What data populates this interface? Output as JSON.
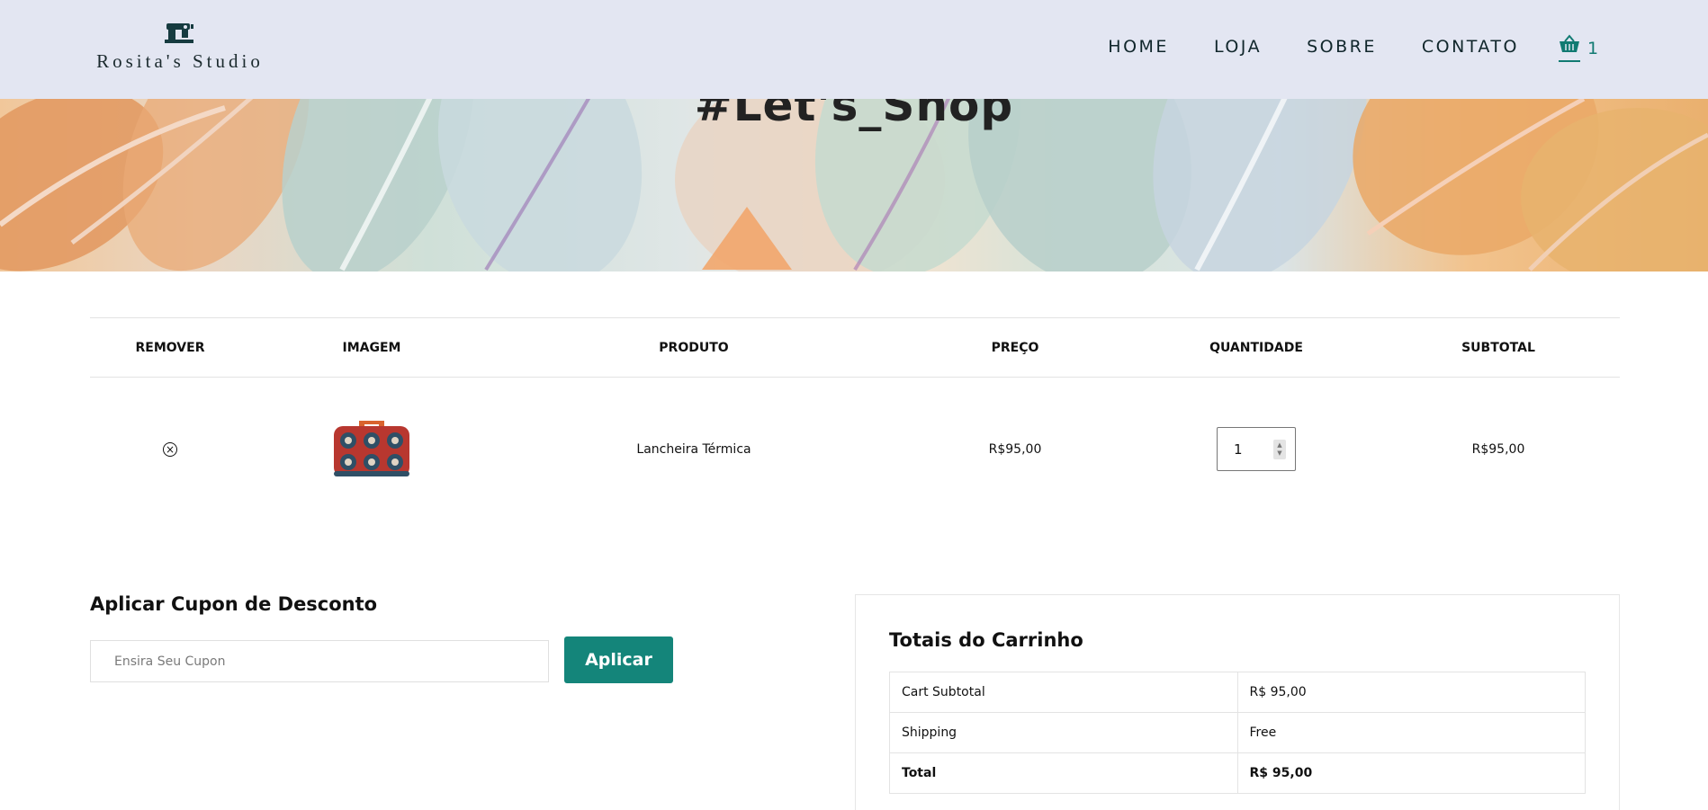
{
  "brand": {
    "name": "Rosita's Studio",
    "icon": "sewing-machine-icon"
  },
  "nav": {
    "items": [
      "HOME",
      "LOJA",
      "SOBRE",
      "CONTATO"
    ]
  },
  "cart": {
    "icon": "basket-icon",
    "count": "1",
    "accent": "#117a72"
  },
  "hero": {
    "title": "#Let's_Shop"
  },
  "table": {
    "headers": [
      "REMOVER",
      "IMAGEM",
      "PRODUTO",
      "PREÇO",
      "QUANTIDADE",
      "SUBTOTAL"
    ],
    "rows": [
      {
        "remove_icon": "remove-circle-icon",
        "image": "lunchbox-product-image",
        "product": "Lancheira Térmica",
        "price": "R$95,00",
        "quantity": "1",
        "subtotal": "R$95,00"
      }
    ]
  },
  "coupon": {
    "title": "Aplicar Cupon de Desconto",
    "placeholder": "Ensira Seu Cupon",
    "button": "Aplicar",
    "button_color": "#14857a"
  },
  "totals": {
    "title": "Totais do Carrinho",
    "rows": [
      {
        "label": "Cart Subtotal",
        "value": "R$ 95,00"
      },
      {
        "label": "Shipping",
        "value": "Free"
      },
      {
        "label": "Total",
        "value": "R$ 95,00"
      }
    ]
  }
}
